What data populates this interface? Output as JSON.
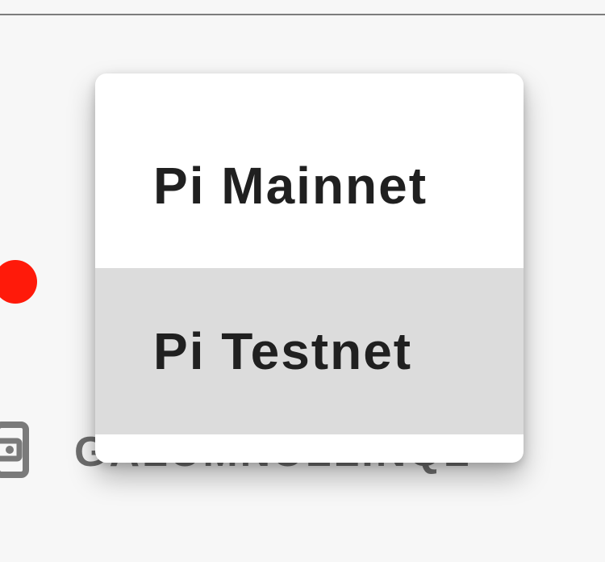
{
  "background_page": {
    "status_dot": {
      "color": "#ff1a0a",
      "state": "online"
    },
    "wallet": {
      "icon": "wallet-icon",
      "address": "GALUMNULLINQL"
    },
    "avatar": {
      "icon": "user-avatar-icon"
    }
  },
  "network_menu": {
    "items": [
      {
        "label": "Pi Mainnet",
        "selected": false
      },
      {
        "label": "Pi Testnet",
        "selected": true
      }
    ],
    "highlight_color": "#d8d8d8"
  }
}
